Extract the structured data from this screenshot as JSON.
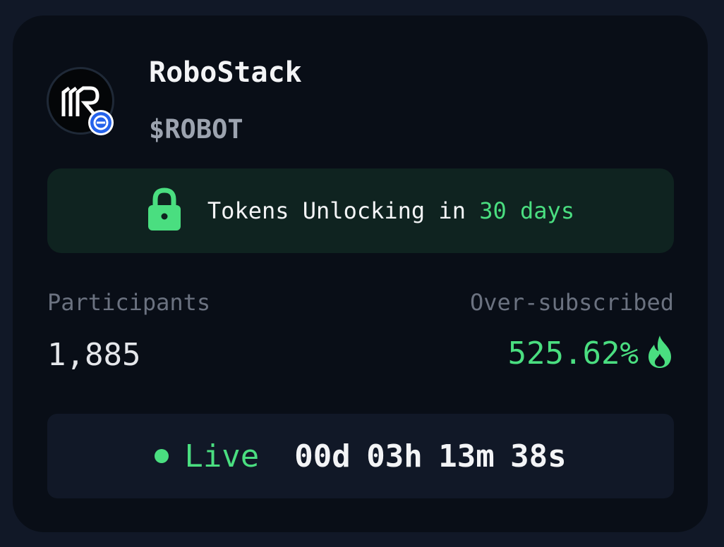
{
  "token": {
    "name": "RoboStack",
    "symbol": "$ROBOT",
    "avatar_icon": "robostack-logo-icon",
    "badge_icon": "chain-badge-icon"
  },
  "unlock": {
    "icon": "lock-icon",
    "prefix": "Tokens Unlocking in ",
    "highlight": "30 days"
  },
  "stats": {
    "participants_label": "Participants",
    "participants_value": "1,885",
    "oversub_label": "Over-subscribed",
    "oversub_value": "525.62%",
    "oversub_icon": "fire-icon"
  },
  "status": {
    "label": "Live",
    "countdown": "00d 03h 13m 38s"
  },
  "colors": {
    "accent_green": "#4ade80",
    "card_bg": "#090e17",
    "page_bg": "#111827"
  }
}
